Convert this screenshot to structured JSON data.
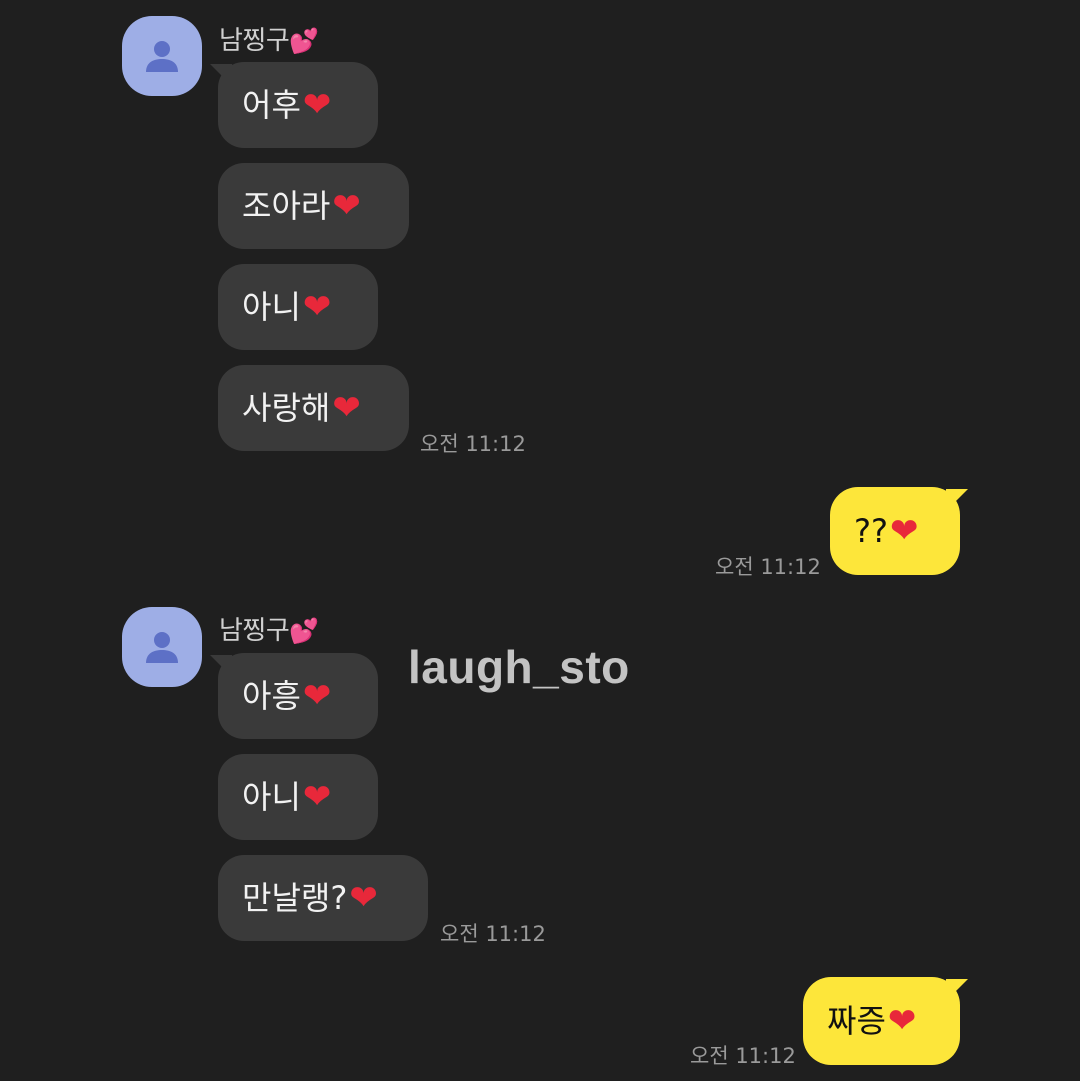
{
  "conversation": {
    "group1": {
      "sender_name": "남찡구",
      "sender_emoji": "💕",
      "messages": [
        "어후",
        "조아라",
        "아니",
        "사랑해"
      ],
      "time": "오전 11:12"
    },
    "reply1": {
      "text": "??",
      "time": "오전 11:12"
    },
    "group2": {
      "sender_name": "남찡구",
      "sender_emoji": "💕",
      "messages": [
        "아흥",
        "아니",
        "만날랭?"
      ],
      "time": "오전 11:12"
    },
    "reply2": {
      "text": "짜증",
      "time": "오전 11:12"
    }
  },
  "heart": "❤",
  "watermark": "laugh_sto",
  "colors": {
    "background": "#1f1f1f",
    "incoming_bubble": "#3a3a3a",
    "outgoing_bubble": "#fde63a",
    "avatar": "#9eaee6",
    "heart": "#e8283a"
  }
}
